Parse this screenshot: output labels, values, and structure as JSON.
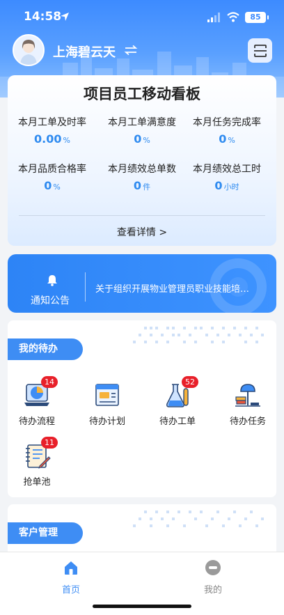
{
  "status_bar": {
    "time": "14:58",
    "battery": "85"
  },
  "header": {
    "org_name": "上海碧云天"
  },
  "dashboard": {
    "title": "项目员工移动看板",
    "metrics": [
      {
        "label": "本月工单及时率",
        "value": "0.00",
        "unit": "%"
      },
      {
        "label": "本月工单满意度",
        "value": "0",
        "unit": "%"
      },
      {
        "label": "本月任务完成率",
        "value": "0",
        "unit": "%"
      },
      {
        "label": "本月品质合格率",
        "value": "0",
        "unit": "%"
      },
      {
        "label": "本月绩效总单数",
        "value": "0",
        "unit": "件"
      },
      {
        "label": "本月绩效总工时",
        "value": "0",
        "unit": "小时"
      }
    ],
    "more_link": "查看详情 >"
  },
  "notice": {
    "label": "通知公告",
    "text": "关于组织开展物业管理员职业技能培…"
  },
  "todo": {
    "section_title": "我的待办",
    "items": [
      {
        "label": "待办流程",
        "badge": "14",
        "icon": "pie-chart-laptop-icon"
      },
      {
        "label": "待办计划",
        "badge": "",
        "icon": "plan-board-icon"
      },
      {
        "label": "待办工单",
        "badge": "52",
        "icon": "flask-icon"
      },
      {
        "label": "待办任务",
        "badge": "",
        "icon": "desk-lamp-books-icon"
      },
      {
        "label": "抢单池",
        "badge": "11",
        "icon": "notebook-pen-icon"
      }
    ]
  },
  "customer": {
    "section_title": "客户管理"
  },
  "tabbar": {
    "items": [
      {
        "label": "首页",
        "active": true,
        "icon": "home-icon"
      },
      {
        "label": "我的",
        "active": false,
        "icon": "profile-icon"
      }
    ]
  },
  "colors": {
    "primary": "#3e8df4",
    "badge": "#e8202a",
    "value": "#2f8bf0"
  }
}
